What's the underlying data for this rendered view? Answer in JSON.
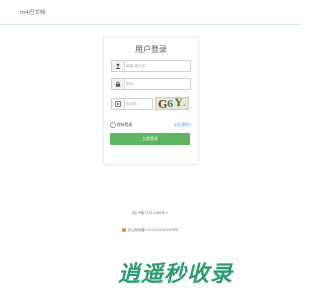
{
  "header": {
    "brand": "m4巴文档"
  },
  "login": {
    "title": "用户登录",
    "username_placeholder": "邮箱/用户名",
    "password_placeholder": "密码",
    "captcha_placeholder": "验证码",
    "captcha_text": "G6 Y",
    "remember_label": "保持登录",
    "forgot_label": "忘记密码?",
    "submit_label": "立即登录"
  },
  "footer": {
    "icp": "京ICP备17013366号-2",
    "police": "京公网安备11011502001900号"
  },
  "watermark": "逍遥秒收录",
  "colors": {
    "primary_button": "#5ab760",
    "link": "#4a90d9",
    "watermark": "#2a9d6f"
  }
}
